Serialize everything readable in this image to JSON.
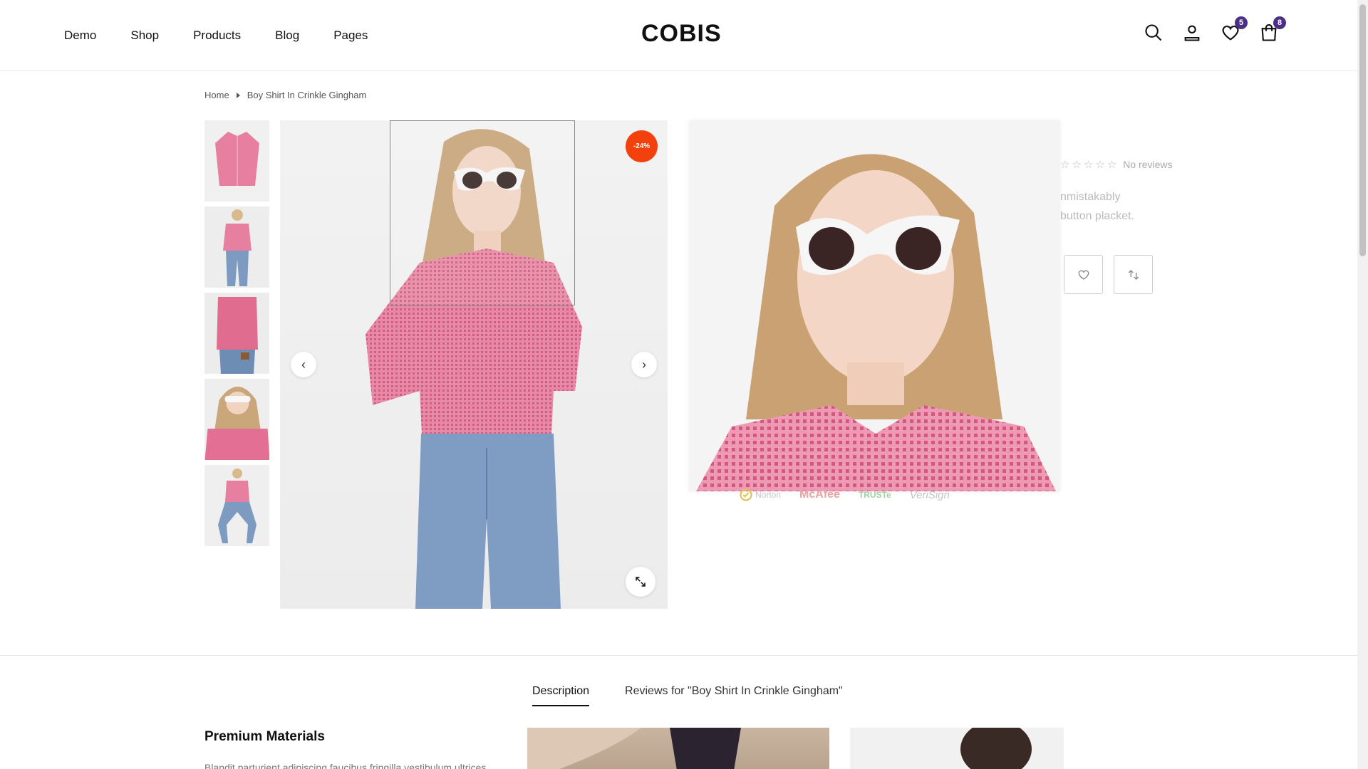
{
  "header": {
    "nav": [
      "Demo",
      "Shop",
      "Products",
      "Blog",
      "Pages"
    ],
    "logo": "COBIS",
    "wishlist_count": "5",
    "cart_count": "8"
  },
  "breadcrumb": {
    "home": "Home",
    "current": "Boy Shirt In Crinkle Gingham"
  },
  "product": {
    "sale_badge": "-24%",
    "reviews_label": "No reviews",
    "desc_line1": "nmistakably",
    "desc_line2": "button placket."
  },
  "trust": [
    "Norton",
    "McAfee",
    "TRUSTe",
    "VeriSign"
  ],
  "tabs": {
    "description": "Description",
    "reviews": "Reviews for \"Boy Shirt In Crinkle Gingham\""
  },
  "section": {
    "title": "Premium Materials",
    "body": "Blandit parturient adipiscing faucibus fringilla vestibulum ultrices"
  },
  "colors": {
    "accent": "#4b2f86",
    "sale": "#f2410c",
    "shirt": "#e26f93"
  }
}
